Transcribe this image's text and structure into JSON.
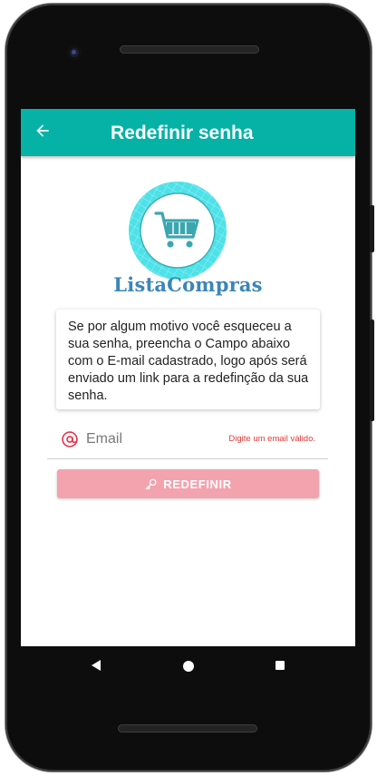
{
  "appbar": {
    "title": "Redefinir senha",
    "back_icon": "arrow-left-icon"
  },
  "logo": {
    "icon": "shopping-cart-icon",
    "brand_text": "ListaCompras"
  },
  "info_card": {
    "text": "Se por algum motivo você esqueceu a sua senha, preencha o Campo abaixo com o E-mail cadastrado, logo após será enviado um link para a redefinção da sua senha."
  },
  "email_field": {
    "icon": "at-sign-icon",
    "placeholder": "Email",
    "value": "",
    "error": "Digite um email válido."
  },
  "submit_button": {
    "icon": "key-icon",
    "label": "REDEFINIR"
  },
  "nav_bar": {
    "back": "nav-back-icon",
    "home": "nav-home-icon",
    "recent": "nav-recent-icon"
  },
  "colors": {
    "primary": "#06b1a6",
    "accent": "#e53935",
    "button": "#f3a3ae",
    "brand_text": "#3b86b8"
  }
}
